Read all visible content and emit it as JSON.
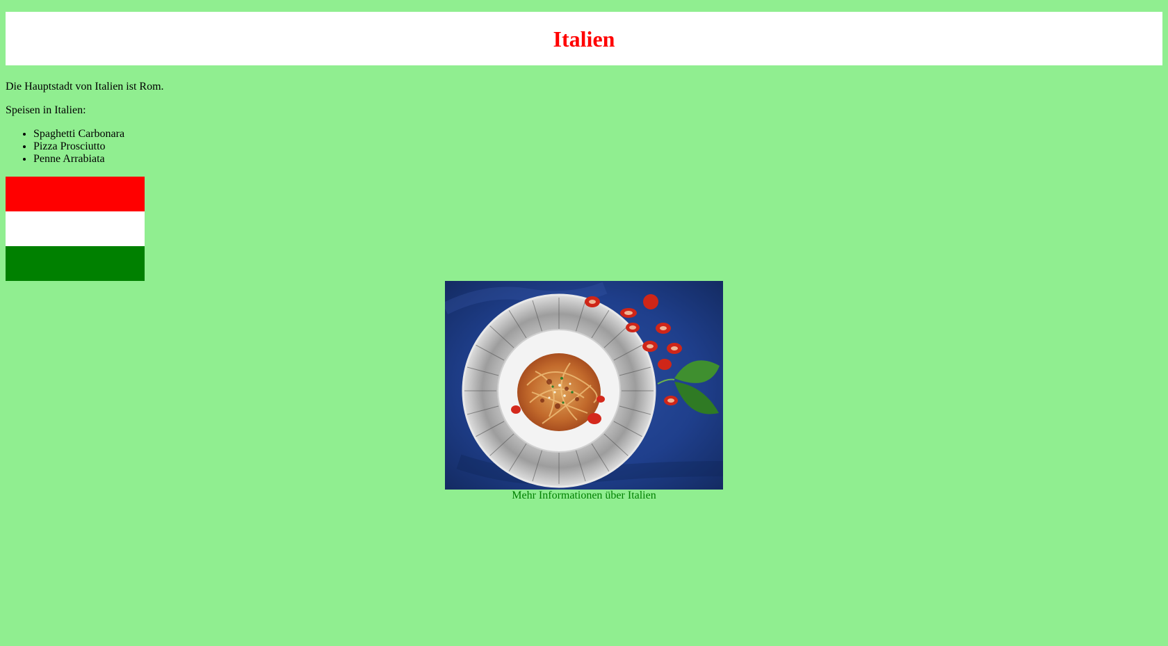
{
  "header": {
    "title": "Italien"
  },
  "capital_text": "Die Hauptstadt von Italien ist Rom.",
  "foods": {
    "label": "Speisen in Italien:",
    "items": [
      "Spaghetti Carbonara",
      "Pizza Prosciutto",
      "Penne Arrabiata"
    ]
  },
  "flag": {
    "colors": [
      "#ff0000",
      "#ffffff",
      "#008000"
    ]
  },
  "image": {
    "subject": "spaghetti-plate-photo"
  },
  "link": {
    "label": "Mehr Informationen über Italien"
  },
  "colors": {
    "page_background": "#90ee90",
    "header_background": "#ffffff",
    "title": "#ff0000",
    "link": "#008000"
  }
}
